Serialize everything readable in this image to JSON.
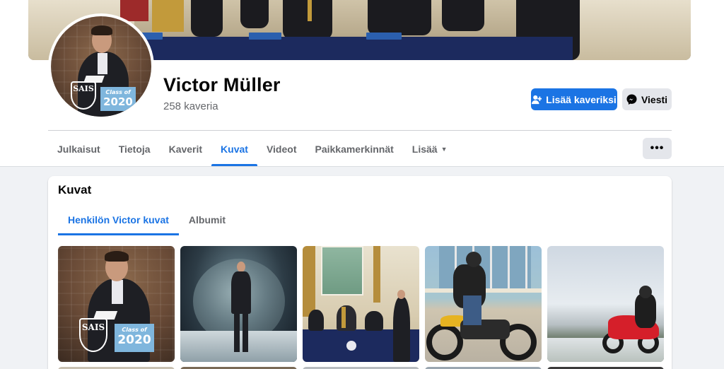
{
  "profile": {
    "name": "Victor Müller",
    "friends": "258 kaveria",
    "avatar_badge_text": "SAIS",
    "avatar_class_text": "Class of",
    "avatar_class_year": "2020"
  },
  "actions": {
    "add_friend": "Lisää kaveriksi",
    "message": "Viesti",
    "more": "•••"
  },
  "tabs": [
    {
      "label": "Julkaisut"
    },
    {
      "label": "Tietoja"
    },
    {
      "label": "Kaverit"
    },
    {
      "label": "Kuvat"
    },
    {
      "label": "Videot"
    },
    {
      "label": "Paikkamerkinnät"
    },
    {
      "label": "Lisää"
    }
  ],
  "active_tab": "Kuvat",
  "photos_section": {
    "title": "Kuvat",
    "subtabs": [
      {
        "label": "Henkilön Victor kuvat"
      },
      {
        "label": "Albumit"
      }
    ]
  },
  "colors": {
    "accent": "#1b74e4",
    "background": "#f0f2f5",
    "secondary_button": "#e4e6eb",
    "muted_text": "#65676b"
  },
  "icons": {
    "add_friend": "person-add-icon",
    "message": "messenger-icon",
    "dropdown": "caret-down-icon",
    "more": "more-horizontal-icon"
  }
}
